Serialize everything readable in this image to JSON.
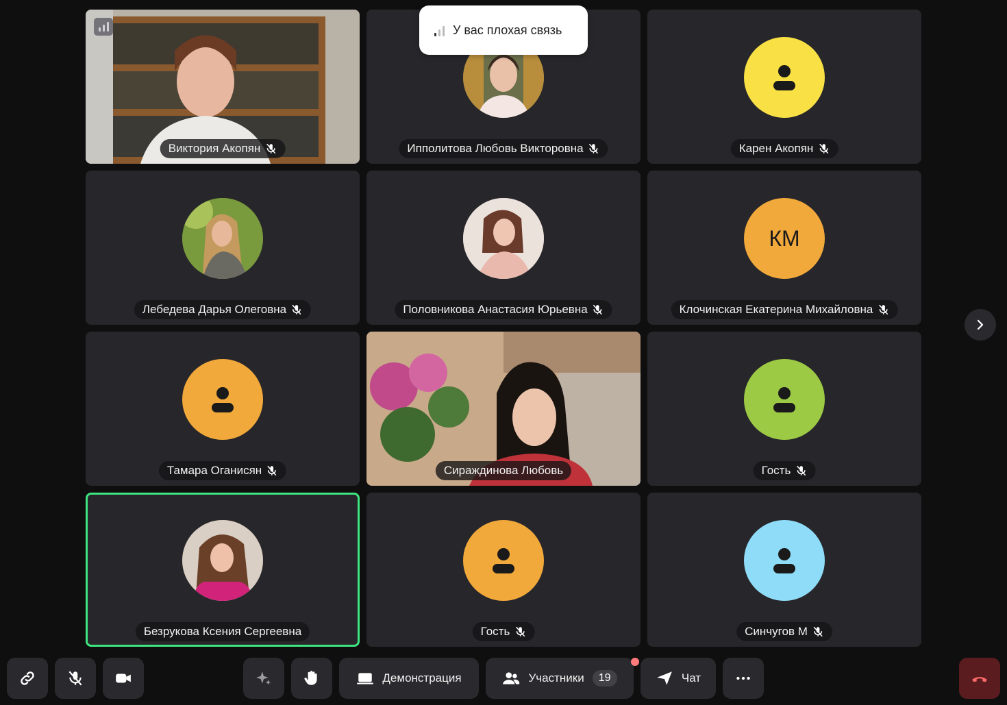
{
  "toast": {
    "text": "У вас плохая связь"
  },
  "participants": [
    {
      "name": "Виктория Акопян",
      "kind": "video"
    },
    {
      "name": "Ипполитова Любовь Викторовна",
      "kind": "photo",
      "bg": "#6b6f4a"
    },
    {
      "name": "Карен Акопян",
      "kind": "icon",
      "color": "#f8e045"
    },
    {
      "name": "Лебедева Дарья Олеговна",
      "kind": "photo",
      "bg": "#6f8a3a"
    },
    {
      "name": "Половникова Анастасия Юрьевна",
      "kind": "photo",
      "bg": "#d9c3bd"
    },
    {
      "name": "Клочинская Екатерина Михайловна",
      "kind": "initials",
      "initials": "КМ",
      "color": "#f2a93b"
    },
    {
      "name": "Тамара Оганисян",
      "kind": "icon",
      "color": "#f2a93b"
    },
    {
      "name": "Сираждинова Любовь",
      "kind": "video"
    },
    {
      "name": "Гость",
      "kind": "icon",
      "color": "#9dca45"
    },
    {
      "name": "Безрукова Ксения Сергеевна",
      "kind": "photo",
      "bg": "#8a6a55",
      "active": true
    },
    {
      "name": "Гость",
      "kind": "icon",
      "color": "#f2a93b"
    },
    {
      "name": "Синчугов М",
      "kind": "icon",
      "color": "#8fdcf8"
    }
  ],
  "toolbar": {
    "demo_label": "Демонстрация",
    "participants_label": "Участники",
    "participants_count": "19",
    "chat_label": "Чат"
  },
  "colors": {
    "active_border": "#3de67f",
    "tile_bg": "#27272b",
    "end_call": "#5a1c1f",
    "notify_dot": "#ff7b7b"
  },
  "icons": [
    "signal-icon",
    "mic-off-icon",
    "person-icon",
    "chevron-right-icon",
    "link-icon",
    "camera-icon",
    "sparkle-icon",
    "raise-hand-icon",
    "screen-share-icon",
    "people-icon",
    "send-icon",
    "more-icon",
    "hang-up-icon"
  ]
}
